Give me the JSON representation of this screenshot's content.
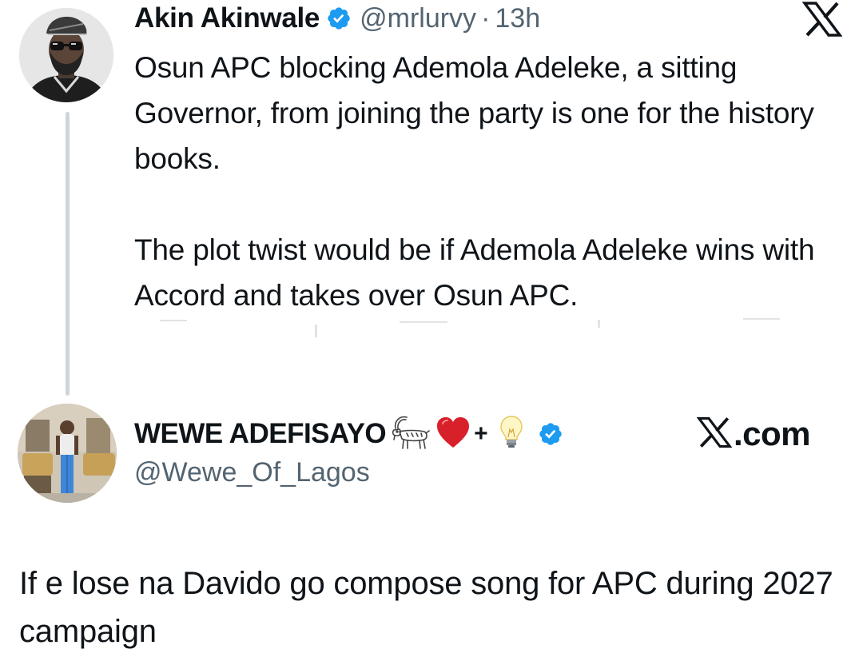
{
  "tweet1": {
    "display_name": "Akin Akinwale",
    "handle": "@mrlurvy",
    "separator": "·",
    "time": "13h",
    "paragraphs": [
      "Osun APC blocking Ademola Adeleke, a sitting Governor, from joining the party is one for the history books.",
      "The plot twist would be if Ademola Adeleke wins with Accord and takes over Osun APC."
    ]
  },
  "tweet2": {
    "display_name": "WEWE ADEFISAYO",
    "plus": "+",
    "handle": "@Wewe_Of_Lagos",
    "source_label": ".com",
    "body": "If e lose na Davido go compose song for APC during 2027 campaign"
  },
  "icons": {
    "verified": "verified-badge-icon",
    "x_logo": "x-logo-icon",
    "goat": "goat-emoji-icon",
    "heart": "red-heart-emoji-icon",
    "bulb": "light-bulb-emoji-icon"
  },
  "colors": {
    "text": "#0f1419",
    "secondary": "#536471",
    "verified_blue": "#1d9bf0",
    "thread_line": "#d0d4d8",
    "heart_red": "#d8202b"
  }
}
